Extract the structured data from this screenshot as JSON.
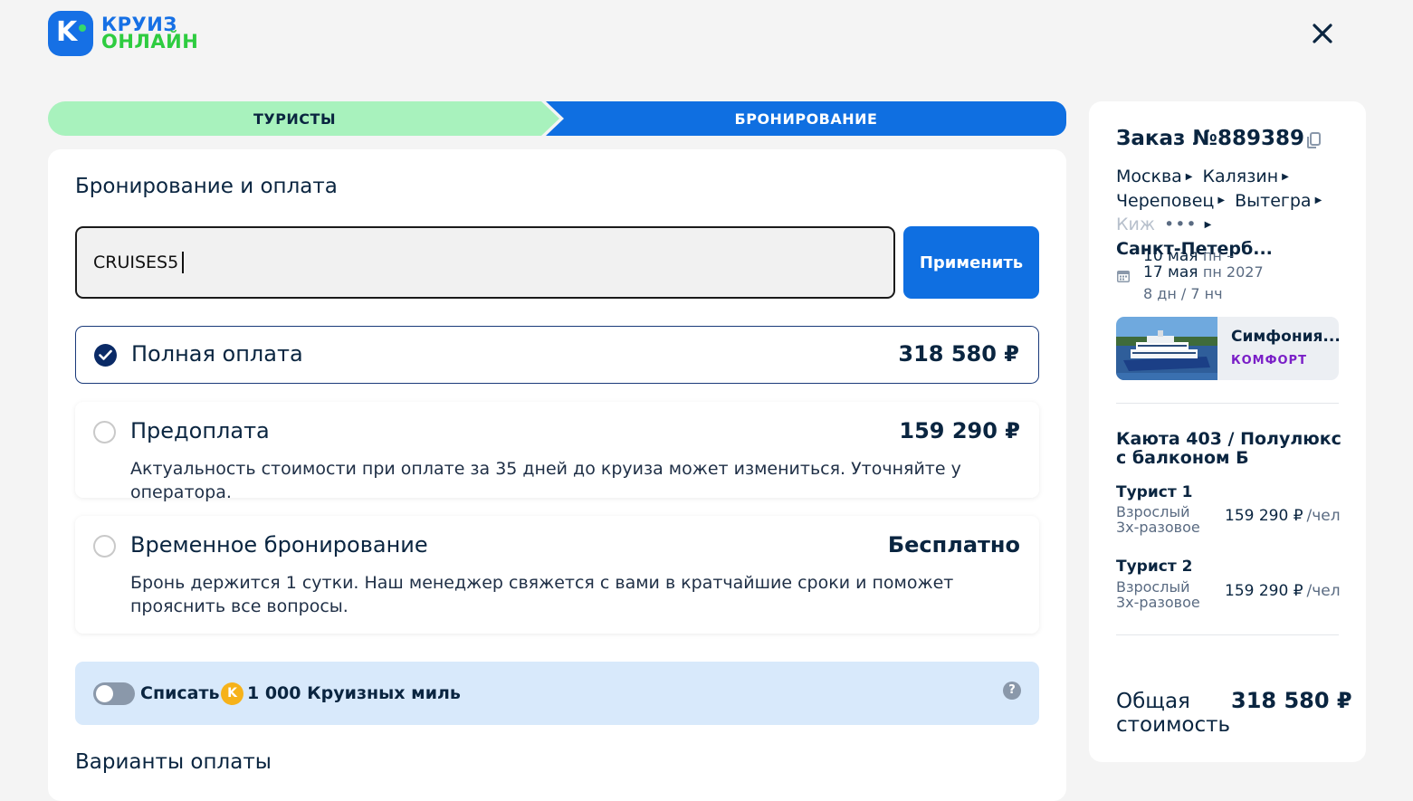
{
  "logo": {
    "line1": "КРУИЗ",
    "line2": "ОНЛАЙН",
    "badge": "K"
  },
  "stepper": {
    "step1": "ТУРИСТЫ",
    "step2": "БРОНИРОВАНИЕ"
  },
  "booking": {
    "title": "Бронирование и оплата",
    "promo_value": "CRUISES5",
    "apply_label": "Применить",
    "options": [
      {
        "title": "Полная оплата",
        "price": "318 580 ₽",
        "selected": true
      },
      {
        "title": "Предоплата",
        "price": "159 290 ₽",
        "description": "Актуальность стоимости при оплате за 35 дней до круиза может измениться. Уточняйте у оператора.",
        "selected": false
      },
      {
        "title": "Временное бронирование",
        "price": "Бесплатно",
        "description": "Бронь держится 1 сутки. Наш менеджер свяжется с вами в кратчайшие сроки и поможет прояснить все вопросы.",
        "selected": false
      }
    ],
    "miles": {
      "label": "Списать",
      "coin": "K",
      "amount": "1 000 Круизных миль",
      "help": "?"
    },
    "payment_variants_title": "Варианты оплаты"
  },
  "order": {
    "title": "Заказ №889389",
    "route": {
      "c1": "Москва",
      "c2": "Калязин",
      "c3": "Череповец",
      "c4": "Вытегра",
      "c5": "Киж",
      "dots": "•••",
      "c6": "Санкт-Петерб..."
    },
    "date_start": "10 мая",
    "weekday_start": "пн",
    "dash": "–",
    "date_end": "17 мая",
    "weekday_end": "пн 2027",
    "duration": "8 дн / 7 нч",
    "ship": {
      "name": "Симфония...",
      "class": "КОМФОРТ"
    },
    "cabin": "Каюта 403 / Полулюкс с балконом Б",
    "tourists": [
      {
        "name": "Турист 1",
        "type_line1": "Взрослый",
        "type_line2": "3х-разовое",
        "price": "159 290 ₽",
        "per": "/чел"
      },
      {
        "name": "Турист 2",
        "type_line1": "Взрослый",
        "type_line2": "3х-разовое",
        "price": "159 290 ₽",
        "per": "/чел"
      }
    ],
    "total_label_1": "Общая",
    "total_label_2": "стоимость",
    "total_value": "318 580 ₽"
  },
  "colors": {
    "primary": "#0f6fe1",
    "step_done": "#a8f2bd",
    "text_dark": "#0a2540",
    "miles_bg": "#d8e9fb",
    "ship_class": "#7a1fc7"
  },
  "icons": {
    "close": "close-icon",
    "copy": "copy-icon",
    "calendar": "calendar-icon",
    "check": "check-icon",
    "help": "help-icon"
  }
}
